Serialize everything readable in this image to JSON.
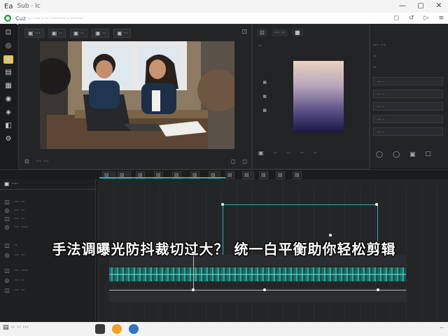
{
  "window": {
    "title": "Ea",
    "subtitle": "Sub  ·  Ic",
    "controls": [
      "—",
      "▢",
      "✕"
    ]
  },
  "addressbar": {
    "url": "Cuz  ·· ····  · ··  ········  · ·······",
    "icons": [
      "◻",
      "↺",
      "▷",
      "≡"
    ]
  },
  "tools": [
    "⊡",
    "◎",
    "▣",
    "▤",
    "▦",
    "◉",
    "◈",
    "◧",
    "⚙"
  ],
  "preview": {
    "tabs": [
      "▣ ···",
      "▣ ··",
      "▣ ··",
      "▣ ··",
      "▣ ··"
    ],
    "footer": [
      "⊡",
      "··· ···"
    ],
    "footer_right": [
      "◻",
      "◻"
    ]
  },
  "color_panel": {
    "tabs": [
      "⊡",
      "··· ··",
      "■"
    ],
    "label": "··",
    "footer": [
      "▣",
      "··",
      "··",
      "··",
      "··"
    ],
    "gradient_colors": [
      "#e9d2bf",
      "#b9a6bd",
      "#5a4f86",
      "#1a1846"
    ]
  },
  "props": {
    "rows": [
      "··· ···",
      "··",
      "··"
    ],
    "fields": [
      "··· ·",
      "··· ·",
      "··· ·",
      "··· ·",
      "··· ·"
    ],
    "footer": [
      "◯",
      "◯",
      "▣",
      "☐"
    ]
  },
  "timeline_toolbar": [
    "▤ ··",
    "▤ ··",
    "▤",
    "▤",
    "▤",
    "▤",
    "▤ ·",
    "▤",
    "▤ ·",
    "▤",
    "▤",
    "▤"
  ],
  "layers": {
    "header": "▣ ····",
    "items": [
      {
        "icon": "◫",
        "label": "··· ··"
      },
      {
        "icon": "◎",
        "label": "··· ··"
      },
      {
        "icon": "◫",
        "label": "··· ··"
      },
      {
        "icon": "◎",
        "label": "··· ····"
      },
      {
        "icon": "◫",
        "label": "··"
      },
      {
        "icon": "◎",
        "label": "··· ··"
      },
      {
        "icon": "◫",
        "label": "··· ····"
      },
      {
        "icon": "◎",
        "label": "··· ··"
      },
      {
        "icon": "◫",
        "label": "··· ··"
      }
    ]
  },
  "caption": "手法调曝光防抖裁切过大？ 统一白平衡助你轻松剪辑",
  "taskbar": {
    "left": "▤ ·· ·· ···",
    "right": "··",
    "icon_colors": [
      "#3a3a3a",
      "#f0a020",
      "#2e74c9"
    ]
  },
  "colors": {
    "accent": "#2bb1b7",
    "wave": "#2da89a"
  }
}
